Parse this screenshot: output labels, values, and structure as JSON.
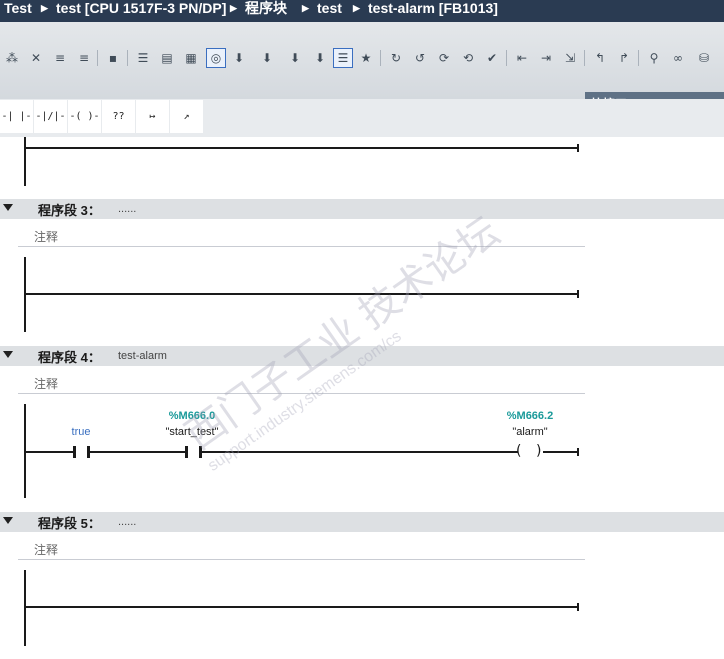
{
  "breadcrumb": {
    "items": [
      "Test",
      "test [CPU 1517F-3 PN/DP]",
      "程序块",
      "test",
      "test-alarm [FB1013]"
    ],
    "separator_icon": "triangle-right-icon"
  },
  "toolbar": {
    "icons": [
      "insert-network-icon",
      "delete-network-icon",
      "insert-row-icon",
      "delete-row-icon",
      "block-call-icon",
      "absolute-address-icon",
      "symbolic-address-icon",
      "network-comments-icon",
      "show-favorites-icon",
      "download-icon",
      "upload-icon",
      "compare-icon",
      "open-all-networks-icon",
      "close-all-networks-icon",
      "monitor-icon",
      "go-to-next-error-icon",
      "go-to-previous-error-icon",
      "update-calls-icon",
      "watch-icon",
      "force-icon",
      "modify-icon",
      "first-network-icon",
      "last-network-icon",
      "jump-to-ref-icon",
      "jump-back-icon",
      "call-hierarchy-icon",
      "monitoring-on-icon",
      "database-icon"
    ],
    "active_indices": [
      7,
      11
    ]
  },
  "block_interface": {
    "label": "块接口"
  },
  "ladder_toolbar": {
    "buttons": [
      "-| |-",
      "-|/|-",
      "-( )-",
      "??",
      "↦",
      "↗"
    ],
    "button_names": [
      "no-contact-button",
      "nc-contact-button",
      "coil-button",
      "empty-box-button",
      "open-branch-button",
      "close-branch-button"
    ]
  },
  "networks": [
    {
      "title": "程序段 3：",
      "subtitle": "......",
      "comment": "注释"
    },
    {
      "title": "程序段 4：",
      "subtitle": "test-alarm",
      "comment": "注释"
    },
    {
      "title": "程序段 5：",
      "subtitle": "......",
      "comment": "注释"
    }
  ],
  "network4_rung": {
    "contact1": {
      "label": "true"
    },
    "contact2": {
      "address": "%M666.0",
      "symbol": "\"start_test\""
    },
    "coil": {
      "address": "%M666.2",
      "symbol": "\"alarm\""
    }
  },
  "watermark": {
    "cn": "西门子工业 技术论坛",
    "url": "support.industry.siemens.com/cs"
  },
  "colors": {
    "titlebar": "#2a3b52",
    "address": "#1a9a9a",
    "true_constant": "#3a6fc0",
    "network_header": "#dde0e3"
  }
}
